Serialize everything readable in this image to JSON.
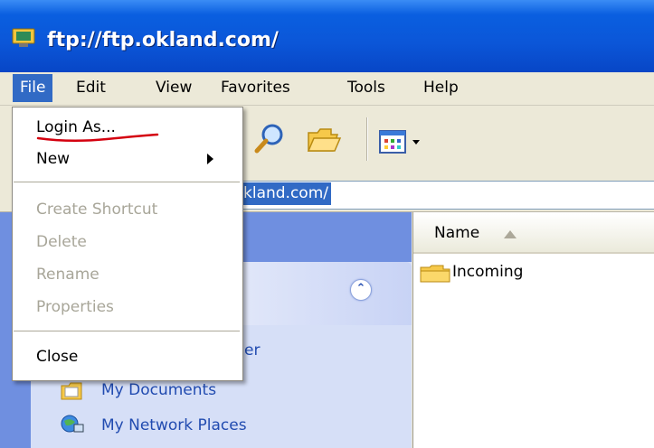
{
  "window": {
    "title": "ftp://ftp.okland.com/",
    "icon": "ftp-folder-icon"
  },
  "menubar": {
    "items": [
      "File",
      "Edit",
      "View",
      "Favorites",
      "Tools",
      "Help"
    ],
    "active": "File"
  },
  "file_menu": {
    "items": [
      {
        "label": "Login As...",
        "enabled": true
      },
      {
        "label": "New",
        "enabled": true,
        "submenu": true
      },
      {
        "label": "Create Shortcut",
        "enabled": false
      },
      {
        "label": "Delete",
        "enabled": false
      },
      {
        "label": "Rename",
        "enabled": false
      },
      {
        "label": "Properties",
        "enabled": false
      },
      {
        "label": "Close",
        "enabled": true
      }
    ],
    "annotation": "red-underline-on-login-as"
  },
  "address_bar": {
    "visible_text": "kland.com/"
  },
  "task_pane": {
    "partial_link": "er",
    "links": [
      "My Documents",
      "My Network Places"
    ]
  },
  "file_list": {
    "column_header": "Name",
    "files": [
      "Incoming"
    ]
  },
  "colors": {
    "title_bar": "#0b56d8",
    "selection": "#316ac5",
    "task_link": "#214bb0",
    "annotation": "#d4000f"
  }
}
